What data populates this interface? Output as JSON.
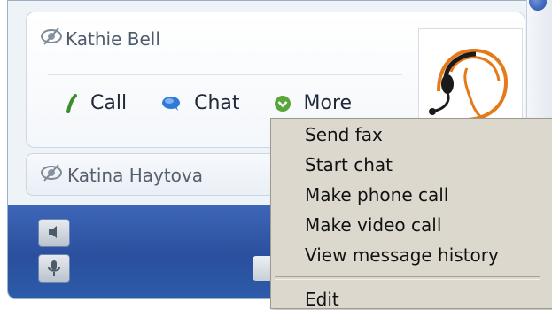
{
  "contact_card": {
    "name": "Kathie Bell",
    "actions": {
      "call_label": "Call",
      "chat_label": "Chat",
      "more_label": "More"
    }
  },
  "contact_row": {
    "name": "Katina Haytova"
  },
  "context_menu": {
    "items": [
      "Send fax",
      "Start chat",
      "Make phone call",
      "Make video call",
      "View message history"
    ],
    "after_separator": [
      "Edit"
    ]
  },
  "icons": {
    "presence": "eye-icon",
    "call": "phone-icon",
    "chat": "chat-bubble-icon",
    "more": "chevron-down-icon",
    "avatar": "headset-operator-icon",
    "speaker": "speaker-icon",
    "mic": "microphone-icon"
  },
  "colors": {
    "window_bg": "#eef3f8",
    "bottom_bar": "#2a4f9d",
    "menu_bg": "#dcd8ce",
    "call_green": "#3a8f2a",
    "chat_blue": "#2f7ad8",
    "more_green": "#5aa63a",
    "avatar_orange": "#e57a1b"
  }
}
